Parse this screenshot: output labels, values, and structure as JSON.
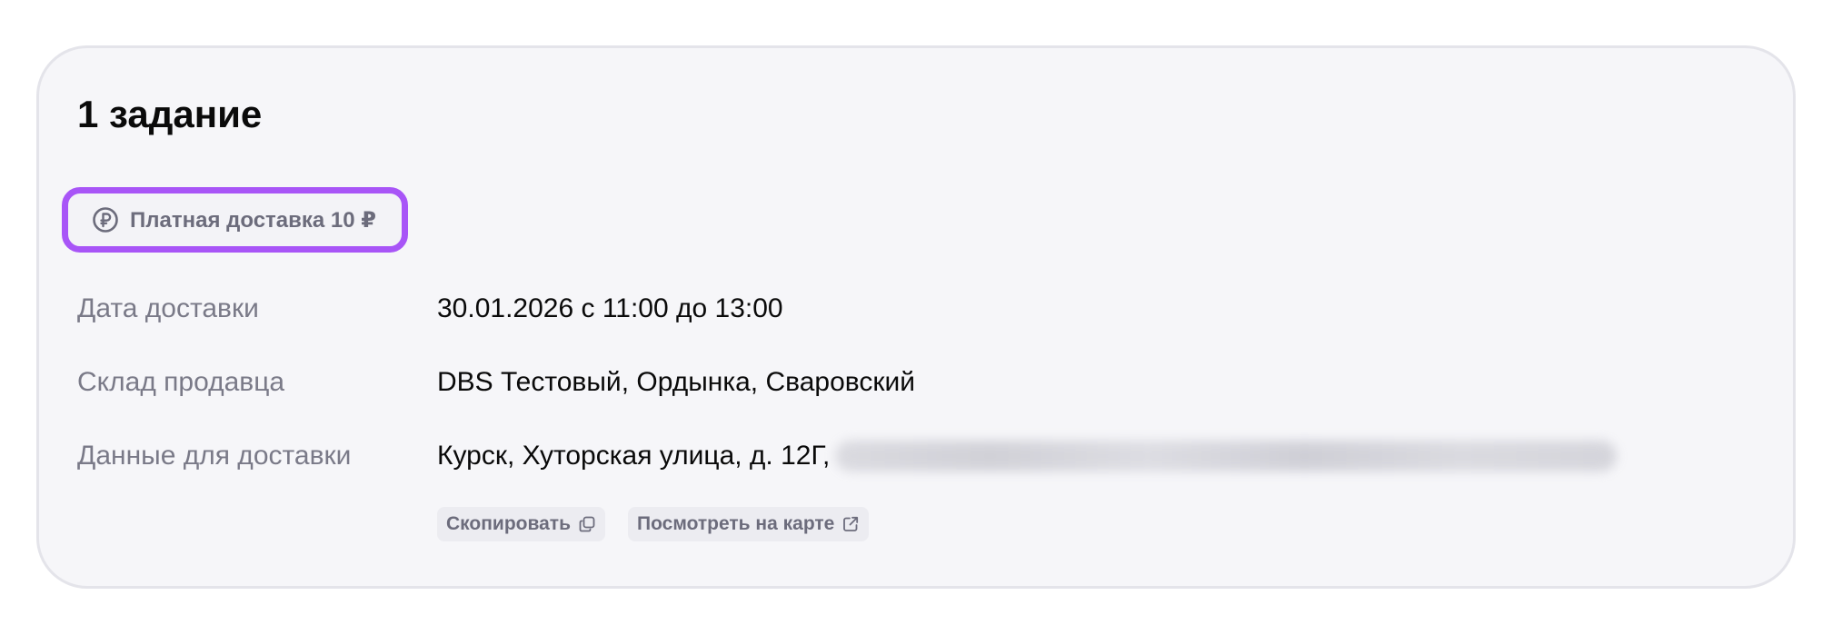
{
  "task": {
    "title": "1 задание",
    "badge": {
      "icon": "ruble-circle-icon",
      "label": "Платная доставка 10 ₽",
      "highlight_color": "#a855f7"
    },
    "rows": [
      {
        "label": "Дата доставки",
        "value": "30.01.2026 с 11:00 до 13:00"
      },
      {
        "label": "Склад продавца",
        "value": "DBS Тестовый, Ордынка, Сваровский"
      },
      {
        "label": "Данные для доставки",
        "value": "Курск, Хуторская улица, д. 12Г,"
      }
    ],
    "actions": {
      "copy_label": "Скопировать",
      "copy_icon": "copy-icon",
      "map_label": "Посмотреть на карте",
      "map_icon": "external-link-icon"
    }
  }
}
